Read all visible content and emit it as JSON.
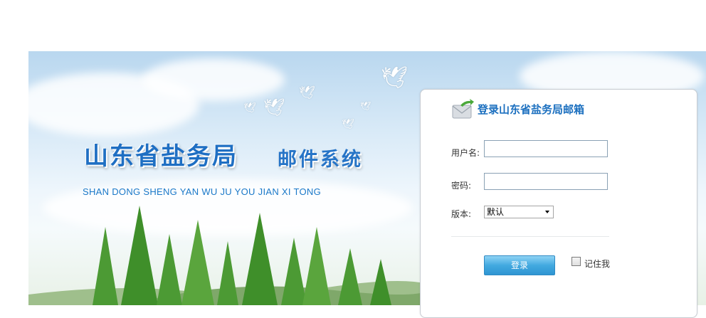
{
  "banner": {
    "title_cn": "山东省盐务局",
    "title_cn_suffix": "邮件系统",
    "title_en": "SHAN DONG SHENG YAN WU JU YOU JIAN XI TONG"
  },
  "login": {
    "title": "登录山东省盐务局邮箱",
    "username_label": "用户名:",
    "username_value": "",
    "password_label": "密码:",
    "password_value": "",
    "version_label": "版本:",
    "version_selected": "默认",
    "submit_label": "登录",
    "remember_label": "记住我",
    "remember_checked": false
  },
  "colors": {
    "accent": "#1b6fbf",
    "button": "#42a9e0",
    "input_border": "#8aa1b4"
  }
}
